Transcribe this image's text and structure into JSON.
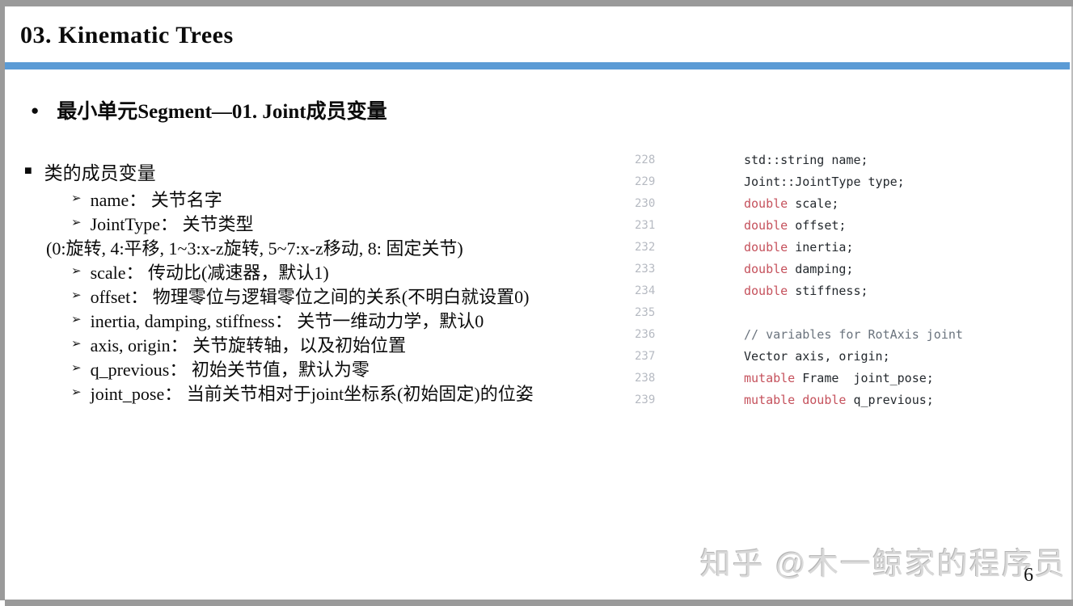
{
  "slide": {
    "title": "03. Kinematic Trees",
    "page_number": "6",
    "watermark": "知乎 @木一鲸家的程序员"
  },
  "colors": {
    "frame_gray": "#9A9A9A",
    "divider_blue": "#5B9BD5",
    "keyword_red": "#C5515C",
    "comment_gray": "#6A737D",
    "line_number_gray": "#B6BAC2",
    "code_text": "#24292E",
    "watermark_gray": "#D9D9D9"
  },
  "bullets": {
    "heading": {
      "marker": "●",
      "text": "最小单元Segment—01. Joint成员变量"
    },
    "subheading": {
      "marker": "■",
      "text": "类的成员变量"
    },
    "items": [
      {
        "marker": "➢",
        "text": "name： 关节名字"
      },
      {
        "marker": "➢",
        "text": "JointType： 关节类型"
      },
      {
        "marker": "",
        "text": "(0:旋转, 4:平移, 1~3:x-z旋转, 5~7:x-z移动, 8: 固定关节)"
      },
      {
        "marker": "➢",
        "text": "scale： 传动比(减速器，默认1)"
      },
      {
        "marker": "➢",
        "text": "offset： 物理零位与逻辑零位之间的关系(不明白就设置0)"
      },
      {
        "marker": "➢",
        "text": "inertia, damping, stiffness： 关节一维动力学，默认0"
      },
      {
        "marker": "➢",
        "text": "axis, origin： 关节旋转轴，以及初始位置"
      },
      {
        "marker": "➢",
        "text": "q_previous： 初始关节值，默认为零"
      },
      {
        "marker": "➢",
        "text": "joint_pose： 当前关节相对于joint坐标系(初始固定)的位姿"
      }
    ]
  },
  "code": {
    "lines": [
      {
        "number": "228",
        "tokens": [
          {
            "type": "plain",
            "text": "std::string name;"
          }
        ]
      },
      {
        "number": "229",
        "tokens": [
          {
            "type": "plain",
            "text": "Joint::JointType type;"
          }
        ]
      },
      {
        "number": "230",
        "tokens": [
          {
            "type": "kw",
            "text": "double"
          },
          {
            "type": "plain",
            "text": " scale;"
          }
        ]
      },
      {
        "number": "231",
        "tokens": [
          {
            "type": "kw",
            "text": "double"
          },
          {
            "type": "plain",
            "text": " offset;"
          }
        ]
      },
      {
        "number": "232",
        "tokens": [
          {
            "type": "kw",
            "text": "double"
          },
          {
            "type": "plain",
            "text": " inertia;"
          }
        ]
      },
      {
        "number": "233",
        "tokens": [
          {
            "type": "kw",
            "text": "double"
          },
          {
            "type": "plain",
            "text": " damping;"
          }
        ]
      },
      {
        "number": "234",
        "tokens": [
          {
            "type": "kw",
            "text": "double"
          },
          {
            "type": "plain",
            "text": " stiffness;"
          }
        ]
      },
      {
        "number": "235",
        "tokens": []
      },
      {
        "number": "236",
        "tokens": [
          {
            "type": "comment",
            "text": "// variables for RotAxis joint"
          }
        ]
      },
      {
        "number": "237",
        "tokens": [
          {
            "type": "plain",
            "text": "Vector axis, origin;"
          }
        ]
      },
      {
        "number": "238",
        "tokens": [
          {
            "type": "kw",
            "text": "mutable"
          },
          {
            "type": "plain",
            "text": " Frame  joint_pose;"
          }
        ]
      },
      {
        "number": "239",
        "tokens": [
          {
            "type": "kw",
            "text": "mutable"
          },
          {
            "type": "plain",
            "text": " "
          },
          {
            "type": "kw",
            "text": "double"
          },
          {
            "type": "plain",
            "text": " q_previous;"
          }
        ]
      }
    ]
  }
}
